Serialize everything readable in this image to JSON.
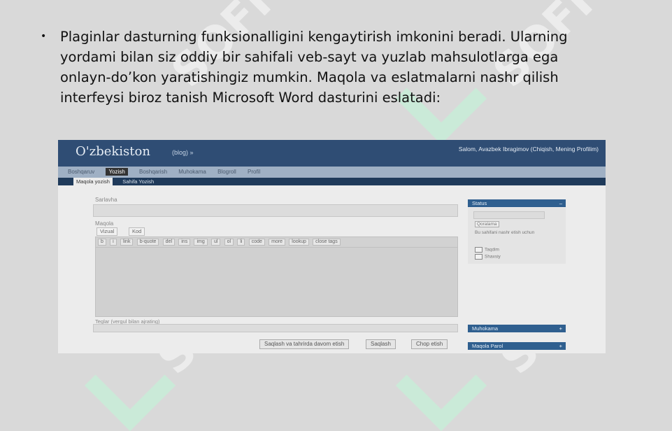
{
  "slide": {
    "bullet_text": "Plaginlar dasturning funksionalligini kengaytirish imkonini beradi. Ularning yordami bilan siz oddiy bir sahifali veb-sayt va yuzlab mahsulotlarga ega onlayn-do’kon yaratishingiz mumkin. Maqola va eslatmalarni nashr qilish interfeysi biroz tanish Microsoft Word dasturini eslatadi:",
    "bullet_glyph": "•",
    "watermark_text": "SOFF"
  },
  "screenshot": {
    "site_title": "O'zbekiston",
    "site_link": "(blog) »",
    "user_info": "Salom, Avazbek Ibragimov (Chiqish, Mening Profilim)",
    "menu": [
      "Boshqaruv",
      "Yozish",
      "Boshqarish",
      "Muhokama",
      "Blogroll",
      "Profil"
    ],
    "active_menu_index": 1,
    "submenu": [
      "Maqola yozish",
      "Sahifa Yozish"
    ],
    "title_label": "Sarlavha",
    "post_label": "Maqola",
    "editor_tabs": [
      "Vizual",
      "Kod"
    ],
    "toolbar_buttons": [
      "b",
      "i",
      "link",
      "b-quote",
      "del",
      "ins",
      "img",
      "ul",
      "ol",
      "li",
      "code",
      "more",
      "lookup",
      "close tags"
    ],
    "tags_label": "Teglar (vergul bilan ajrating)",
    "buttons": {
      "save_continue": "Saqlash va tahrirda davom etish",
      "save": "Saqlash",
      "publish": "Chop etish"
    },
    "sidebar": {
      "status_title": "Status",
      "status_value": "Qoralama",
      "status_note": "Bu sahifani nashr etish uchun",
      "checkbox_1": "Taqdim",
      "checkbox_2": "Shaxsiy",
      "panel_2_title": "Muhokama",
      "panel_3_title": "Maqola Parol",
      "collapse_glyph": "–",
      "expand_glyph": "+"
    }
  },
  "colors": {
    "slide_bg": "#d9d9d9",
    "topbar": "#2f4d74",
    "panel_header": "#2f5f8f",
    "watermark_chevron": "#c9ecd8"
  }
}
